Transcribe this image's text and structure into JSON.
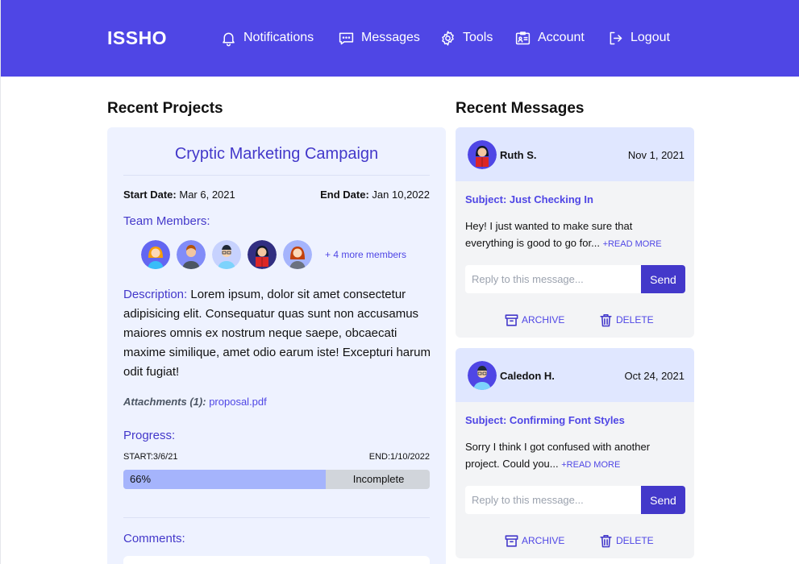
{
  "header": {
    "brand": "ISSHO",
    "nav": [
      {
        "label": "Notifications",
        "icon": "bell-icon"
      },
      {
        "label": "Messages",
        "icon": "chat-icon"
      },
      {
        "label": "Tools",
        "icon": "gear-icon"
      },
      {
        "label": "Account",
        "icon": "id-card-icon"
      },
      {
        "label": "Logout",
        "icon": "logout-icon"
      }
    ]
  },
  "projects": {
    "section_title": "Recent Projects",
    "card": {
      "title": "Cryptic Marketing Campaign",
      "start_label": "Start Date:",
      "start_value": "Mar 6, 2021",
      "end_label": "End Date:",
      "end_value": "Jan 10,2022",
      "team_label": "Team Members:",
      "more_members": "+ 4 more members",
      "description_label": "Description:",
      "description_text": "Lorem ipsum, dolor sit amet consectetur adipisicing elit. Consequatur quas sunt non accusamus maiores omnis ex nostrum neque saepe, obcaecati maxime similique, amet odio earum iste! Excepturi harum odit fugiat!",
      "attachments_label": "Attachments (1):",
      "attachment_file": "proposal.pdf",
      "progress_label": "Progress:",
      "progress_start": "START:3/6/21",
      "progress_end": "END:1/10/2022",
      "progress_percent": "66%",
      "progress_fraction": 0.66,
      "progress_status": "Incomplete",
      "comments_label": "Comments:"
    }
  },
  "messages": {
    "section_title": "Recent Messages",
    "items": [
      {
        "name": "Ruth S.",
        "date": "Nov 1, 2021",
        "subject": "Subject: Just Checking In",
        "body": "Hey! I just wanted to make sure that everything is good to go for...",
        "read_more": "+READ MORE",
        "reply_placeholder": "Reply to this message...",
        "send": "Send",
        "archive": "ARCHIVE",
        "delete": "DELETE"
      },
      {
        "name": "Caledon H.",
        "date": "Oct 24, 2021",
        "subject": "Subject: Confirming Font Styles",
        "body": "Sorry I think I got confused with another project. Could you...",
        "read_more": "+READ MORE",
        "reply_placeholder": "Reply to this message...",
        "send": "Send",
        "archive": "ARCHIVE",
        "delete": "DELETE"
      }
    ]
  },
  "colors": {
    "header_bg": "#4f46e5",
    "accent": "#4338ca",
    "card_bg": "#eef2ff",
    "message_header_bg": "#e0e7ff",
    "progress_fill": "#a5b4fc"
  }
}
